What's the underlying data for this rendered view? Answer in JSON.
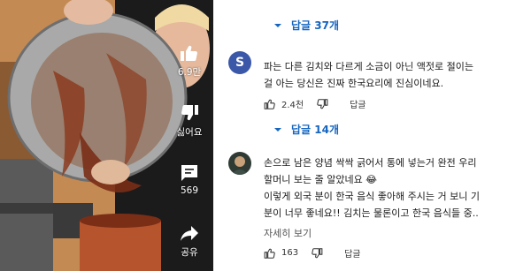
{
  "video": {
    "actions": [
      {
        "icon": "thumbs-up-icon",
        "label": "6.9만"
      },
      {
        "icon": "thumbs-down-icon",
        "label": "싫어요"
      },
      {
        "icon": "comment-icon",
        "label": "569"
      },
      {
        "icon": "share-icon",
        "label": "공유"
      }
    ]
  },
  "replies_top": {
    "label": "답글 37개"
  },
  "comment1": {
    "avatar_letter": "S",
    "lines": [
      "파는 다른 김치와 다르게 소금이 아닌 액젓로 절이는",
      "걸 아는 당신은 진짜 한국요리에 진심이네요."
    ],
    "likes": "2.4천",
    "reply_label": "답글"
  },
  "replies_c1": {
    "label": "답글 14개"
  },
  "comment2": {
    "lines": [
      "손으로 남은 양념 싹싹 긁어서 통에 넣는거 완전 우리",
      "할머니 보는 줄 알았네요 😂",
      "이렇게 외국 분이 한국 음식 좋아해 주시는 거 보니 기",
      "분이 너무 좋네요!! 김치는 물론이고 한국 음식들 중.."
    ],
    "more_label": "자세히 보기",
    "likes": "163",
    "reply_label": "답글"
  }
}
